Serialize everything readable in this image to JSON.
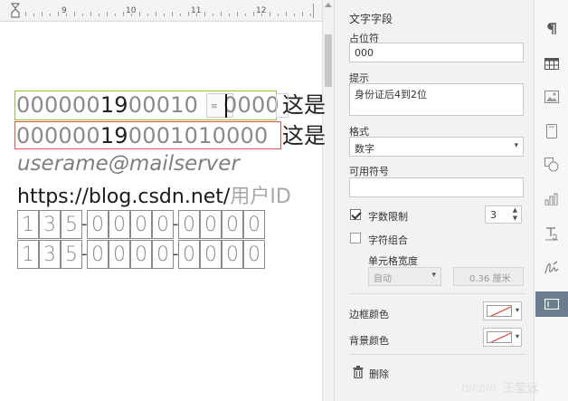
{
  "ruler": {
    "numbers": [
      "9",
      "10",
      "11",
      "12"
    ]
  },
  "document": {
    "field1": {
      "prefix": "000000",
      "mid": "19",
      "suffix": "00010",
      "after_caret": "0000",
      "trailing": "这是"
    },
    "field2": {
      "prefix": "000000",
      "mid": "19",
      "suffix": "00010",
      "after": "10000",
      "trailing": "这是"
    },
    "email_placeholder": "userame@mailserver",
    "url_text": "https://blog.csdn.net/",
    "url_placeholder": "用户ID",
    "cell_rows": [
      [
        "1",
        "3",
        "5",
        "-",
        "0",
        "0",
        "0",
        "0",
        "-",
        "0",
        "0",
        "0",
        "0"
      ],
      [
        "1",
        "3",
        "5",
        "-",
        "0",
        "0",
        "0",
        "0",
        "-",
        "0",
        "0",
        "0",
        "0"
      ]
    ]
  },
  "panel": {
    "title": "文字字段",
    "placeholder_label": "占位符",
    "placeholder_value": "000",
    "hint_label": "提示",
    "hint_value": "身份证后4到2位",
    "format_label": "格式",
    "format_value": "数字",
    "allowed_symbols_label": "可用符号",
    "allowed_symbols_value": "",
    "digit_limit_label": "字数限制",
    "digit_limit_checked": true,
    "digit_limit_value": "3",
    "char_combo_label": "字符组合",
    "char_combo_checked": false,
    "cell_width_label": "单元格宽度",
    "cell_width_mode": "自动",
    "cell_width_value": "0.36 厘米",
    "border_color_label": "边框颜色",
    "bg_color_label": "背景颜色",
    "delete_label": "删除"
  },
  "toolbar": {
    "icons": [
      "paragraph-icon",
      "table-icon",
      "image-icon",
      "page-icon",
      "shapes-icon",
      "chart-icon",
      "text-style-icon",
      "signature-icon",
      "form-field-icon"
    ],
    "active": "form-field-icon"
  },
  "colors": {
    "field1_border": "#8cc43d",
    "field2_border": "#d9534f",
    "active_tool_bg": "#6b7d8f",
    "panel_bg": "#f2f2f2"
  },
  "watermark": {
    "brand": "bilibili",
    "name": "王莹远"
  }
}
